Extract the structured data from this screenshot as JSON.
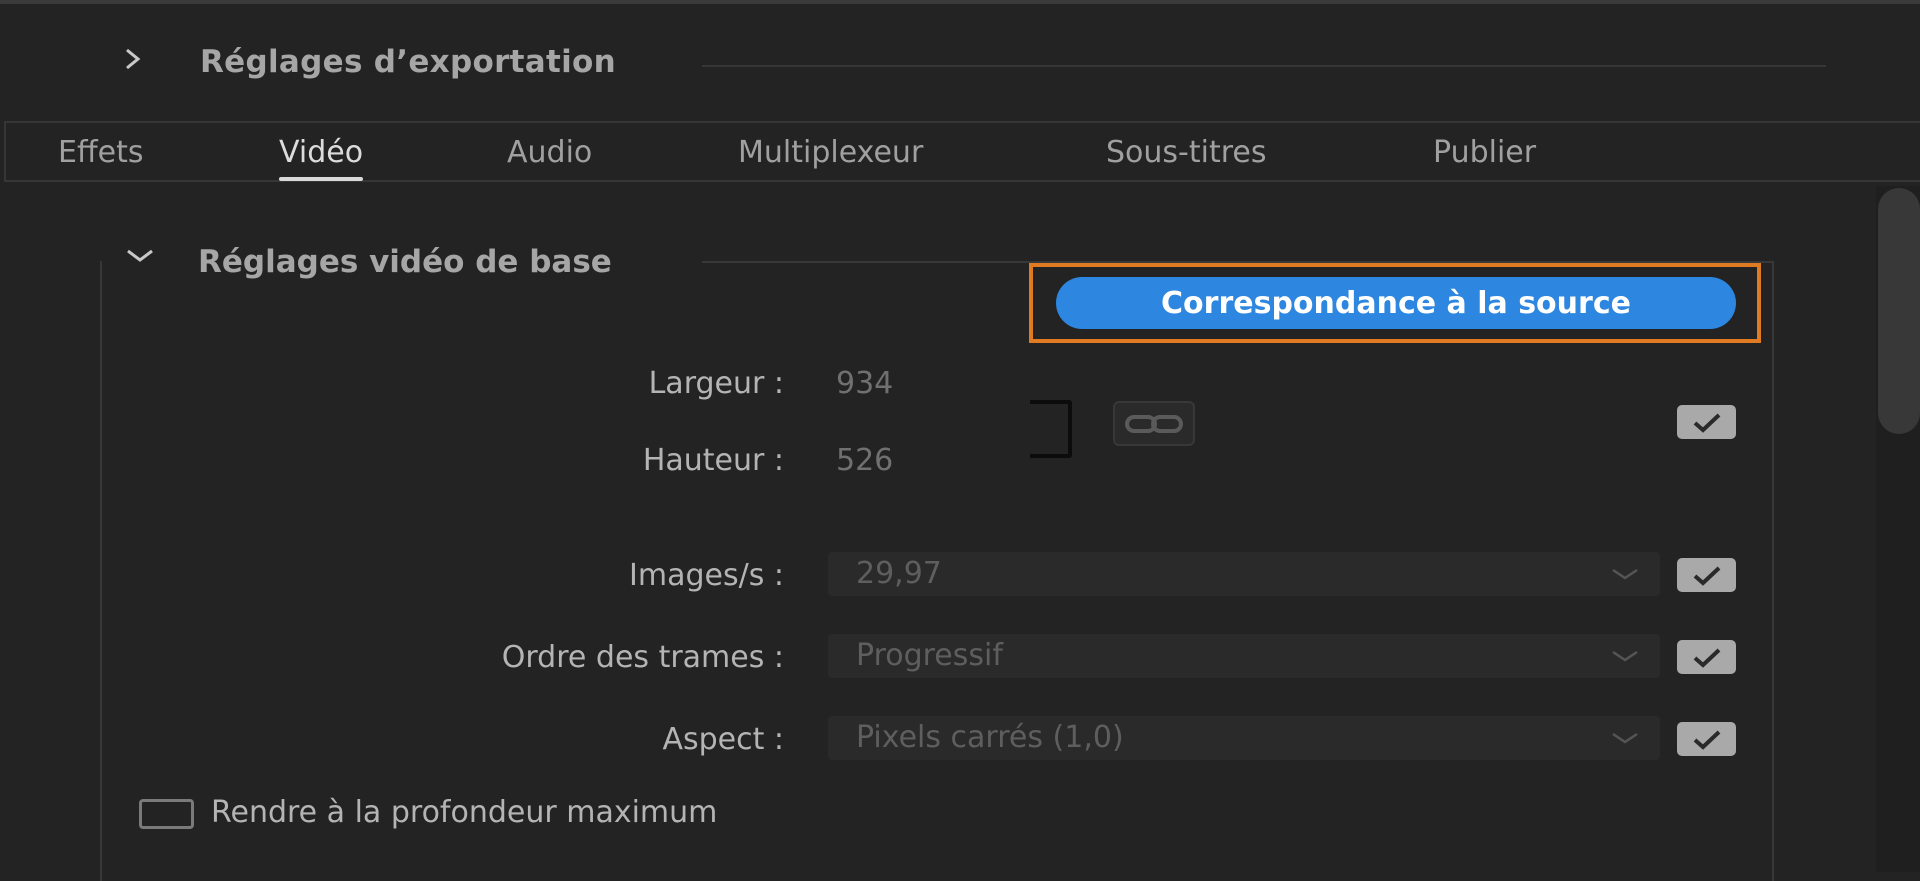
{
  "export_settings": {
    "title": "Réglages d’exportation"
  },
  "tabs": [
    {
      "label": "Effets"
    },
    {
      "label": "Vidéo",
      "active": true
    },
    {
      "label": "Audio"
    },
    {
      "label": "Multiplexeur"
    },
    {
      "label": "Sous-titres"
    },
    {
      "label": "Publier"
    }
  ],
  "basic_video": {
    "title": "Réglages vidéo de base",
    "match_source_label": "Correspondance à la source",
    "width": {
      "label": "Largeur :",
      "value": "934"
    },
    "height": {
      "label": "Hauteur :",
      "value": "526"
    },
    "frame_rate": {
      "label": "Images/s :",
      "value": "29,97",
      "matched": true
    },
    "field_order": {
      "label": "Ordre des trames :",
      "value": "Progressif",
      "matched": true
    },
    "aspect": {
      "label": "Aspect :",
      "value": "Pixels carrés (1,0)",
      "matched": true
    },
    "dimensions_matched": true,
    "max_depth": {
      "label": "Rendre à la profondeur maximum",
      "checked": false
    }
  },
  "icons": {
    "export_section": "chevron-right-icon",
    "basic_section": "chevron-down-icon",
    "link": "link-icon",
    "check": "checkmark-icon",
    "dropdown": "chevron-down-icon"
  },
  "colors": {
    "background": "#232323",
    "accent_button": "#2d86e0",
    "highlight_border": "#e07b23",
    "checkbox_fill": "#a9a9a9"
  }
}
